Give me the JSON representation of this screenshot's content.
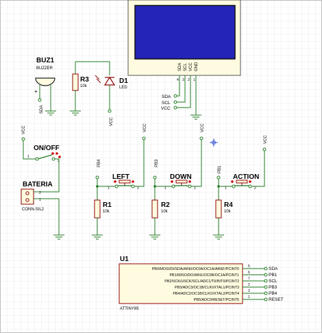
{
  "colors": {
    "grid": "#d9d9d9",
    "wire": "#1e7a1e",
    "lcd_screen": "#2424b8",
    "lcd_body": "#fffbe0",
    "part_fill": "#fffbe0",
    "part_border": "#8b0000",
    "pin_dot": "#cc0000",
    "text": "#000000"
  },
  "lcd": {
    "pins": [
      "SDA",
      "SCL",
      "VCC",
      "GND"
    ],
    "pin_numbers": [
      "4",
      "3",
      "2",
      "1"
    ]
  },
  "buzzer": {
    "ref": "BUZ1",
    "name": "BUZZER",
    "pin_plus": "+",
    "net": "SDA"
  },
  "r3": {
    "ref": "R3",
    "value": "10k"
  },
  "led": {
    "ref": "D1",
    "name": "LED",
    "net": "VCC"
  },
  "lcd_nets": {
    "sda": "SDA",
    "scl": "SCL",
    "vcc": "VCC"
  },
  "power_switch": {
    "ref": "ON/OFF",
    "vcc": "VCC",
    "pins": [
      "1",
      "2"
    ]
  },
  "battery": {
    "ref": "BATERIA",
    "name": "CONN-SIL2",
    "pins": [
      "2",
      "1"
    ]
  },
  "buttons": [
    {
      "ref": "LEFT",
      "net": "PB4",
      "vcc": "VCC",
      "pins": [
        "1",
        "2"
      ]
    },
    {
      "ref": "DOWN",
      "net": "PB3",
      "vcc": "VCC",
      "pins": [
        "1",
        "2"
      ]
    },
    {
      "ref": "ACTION",
      "net": "PB1",
      "vcc": "VCC",
      "pins": [
        "1",
        "2"
      ]
    }
  ],
  "resistors": [
    {
      "ref": "R1",
      "value": "10k"
    },
    {
      "ref": "R2",
      "value": "10k"
    },
    {
      "ref": "R4",
      "value": "10k"
    }
  ],
  "mcu": {
    "ref": "U1",
    "name": "ATTINY85",
    "pins": [
      {
        "label": "PB0/MOSI/DI/SDA/AIN0/OC0A/OC1A/AREF/PCINT0",
        "num": "5",
        "net": "SDA"
      },
      {
        "label": "PB1/MISO/DO/AIN1/OC0B/OC1A/PCINT1",
        "num": "6",
        "net": "PB1"
      },
      {
        "label": "PB2/SCK/USCK/SCL/ADC1/T0/INT0/PCINT2",
        "num": "7",
        "net": "SCL"
      },
      {
        "label": "PB3/ADC3/OC1B/CLKI/XTAL1/PCINT3",
        "num": "2",
        "net": "PB3"
      },
      {
        "label": "PB4/ADC2/OC1B/CLKO/XTAL2/PCINT4",
        "num": "3",
        "net": "PB4"
      },
      {
        "label": "PB5/ADC0/RESET/PCINT5",
        "num": "1",
        "net": "RESET"
      }
    ]
  }
}
